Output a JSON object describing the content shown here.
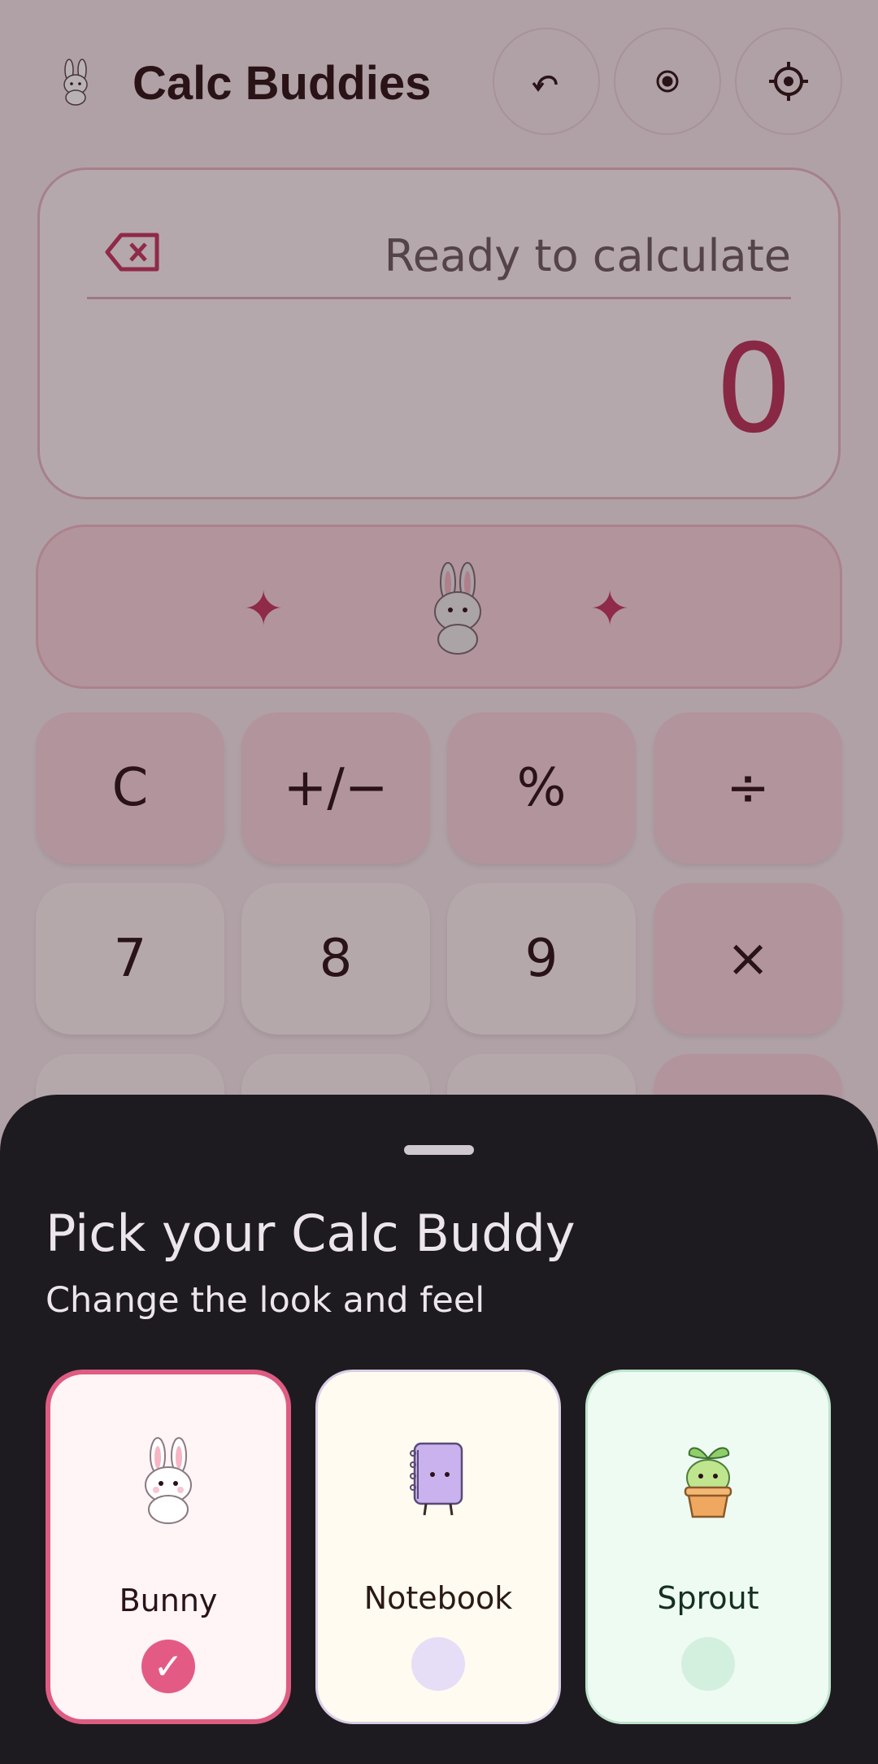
{
  "app": {
    "title": "Calc Buddies",
    "accent": "#b8325a"
  },
  "toolbar": {
    "undo_icon": "undo-icon",
    "record_icon": "record-icon",
    "settings_icon": "gear-icon"
  },
  "display": {
    "status": "Ready to calculate",
    "result": "0"
  },
  "keypad": {
    "row1": [
      "C",
      "+/−",
      "%",
      "÷"
    ],
    "row2": [
      "7",
      "8",
      "9",
      "×"
    ]
  },
  "sheet": {
    "title": "Pick your Calc Buddy",
    "subtitle": "Change the look and feel",
    "options": [
      {
        "name": "Bunny",
        "selected": true,
        "check": "✓",
        "bg": "#fff4f6",
        "border": "#de5c82",
        "radio": "#e35b84"
      },
      {
        "name": "Notebook",
        "selected": false,
        "check": "",
        "bg": "#fffbf0",
        "border": "#d8cde6",
        "radio": "#e6def6"
      },
      {
        "name": "Sprout",
        "selected": false,
        "check": "",
        "bg": "#eefbf3",
        "border": "#bfe3cd",
        "radio": "#d3f0de"
      }
    ]
  }
}
